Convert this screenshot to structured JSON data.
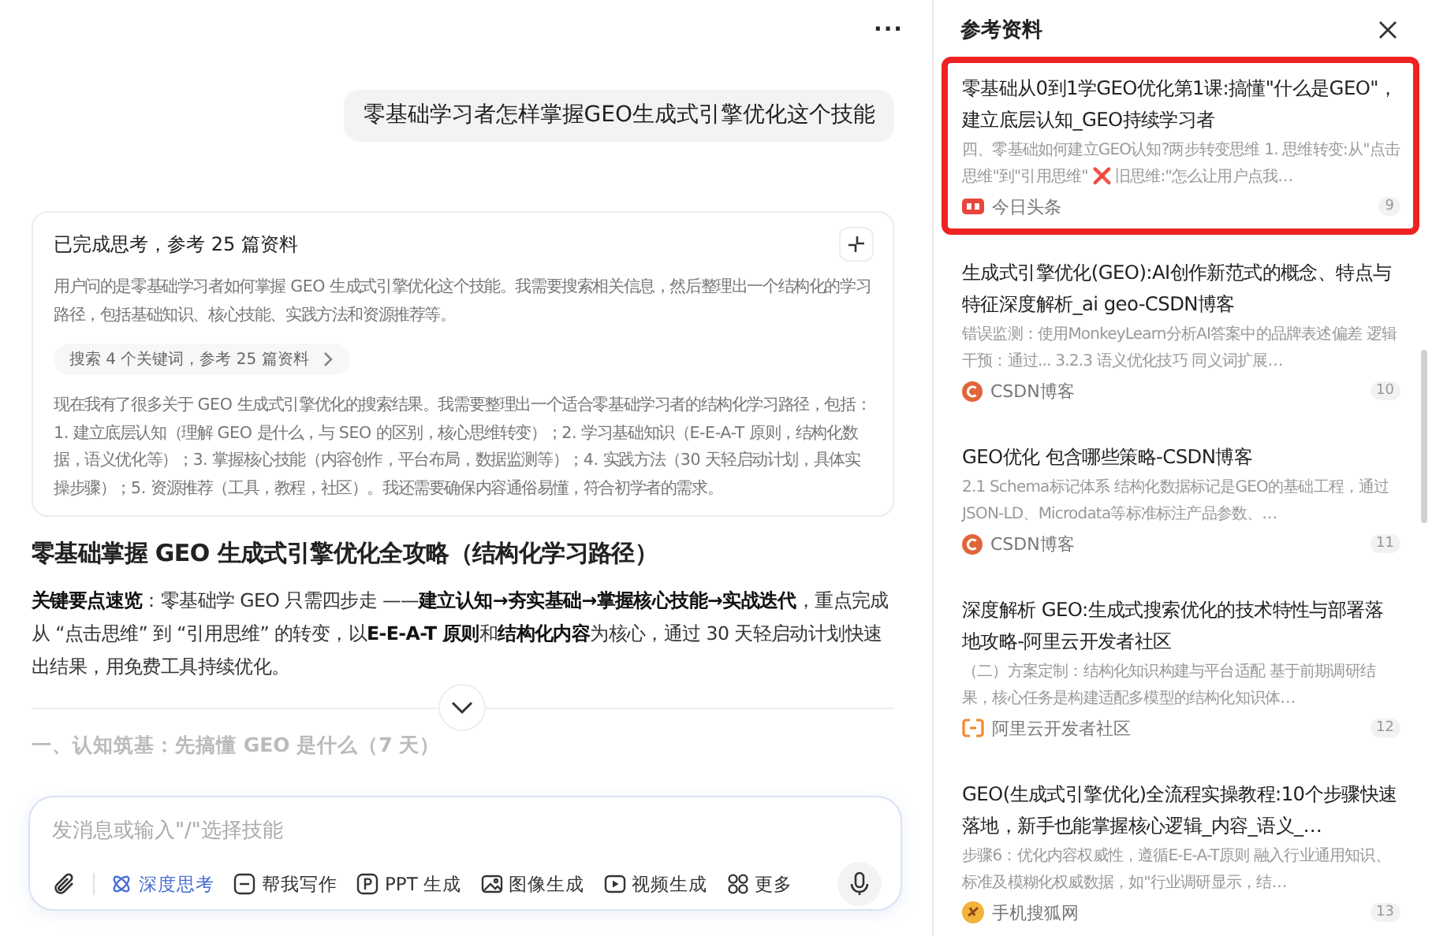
{
  "chat": {
    "menu_icon": "···",
    "user_message": "零基础学习者怎样掌握GEO生成式引擎优化这个技能",
    "thinking": {
      "title": "已完成思考，参考 25 篇资料",
      "expanded": true,
      "paragraphs": [
        "用户问的是零基础学习者如何掌握 GEO 生成式引擎优化这个技能。我需要搜索相关信息，然后整理出一个结构化的学习路径，包括基础知识、核心技能、实践方法和资源推荐等。",
        "现在我有了很多关于 GEO 生成式引擎优化的搜索结果。我需要整理出一个适合零基础学习者的结构化学习路径，包括：1. 建立底层认知（理解 GEO 是什么，与 SEO 的区别，核心思维转变）；2. 学习基础知识（E-E-A-T 原则，结构化数据，语义优化等）；3. 掌握核心技能（内容创作，平台布局，数据监测等）；4. 实践方法（30 天轻启动计划，具体实操步骤）；5. 资源推荐（工具，教程，社区）。我还需要确保内容通俗易懂，符合初学者的需求。"
      ],
      "search_chip": "搜索 4 个关键词，参考 25 篇资料"
    },
    "answer_title": "零基础掌握 GEO 生成式引擎优化全攻略（结构化学习路径）",
    "answer_paragraph": "**关键要点速览**：零基础学 GEO 只需四步走 ——**建立认知→夯实基础→掌握核心技能→实战迭代**，重点完成从 “点击思维” 到 “引用思维” 的转变，以**E-E-A-T 原则**和**结构化内容**为核心，通过 30 天轻启动计划快速出结果，用免费工具持续优化。",
    "next_section": "一、认知筑基：先搞懂 GEO 是什么（7 天）",
    "input": {
      "placeholder": "发消息或输入\"/\"选择技能",
      "tools": [
        {
          "kind": "thinking",
          "label": "深度思考",
          "selected": true
        },
        {
          "kind": "writing",
          "label": "帮我写作",
          "selected": false
        },
        {
          "kind": "ppt",
          "label": "PPT 生成",
          "selected": false
        },
        {
          "kind": "image",
          "label": "图像生成",
          "selected": false
        },
        {
          "kind": "video",
          "label": "视频生成",
          "selected": false
        },
        {
          "kind": "more",
          "label": "更多",
          "selected": false
        }
      ]
    }
  },
  "references": {
    "title": "参考资料",
    "items": [
      {
        "title": "零基础从0到1学GEO优化第1课:搞懂\"什么是GEO\"，建立底层认知_GEO持续学习者",
        "snippet": "四、零基础如何建立GEO认知?两步转变思维 1. 思维转变:从\"点击思维\"到\"引用思维\" ❌ 旧思维:\"怎么让用户点我…",
        "source": "今日头条",
        "kind": "toutiao",
        "number": "9",
        "highlighted": true
      },
      {
        "title": "生成式引擎优化(GEO):AI创作新范式的概念、特点与特征深度解析_ai geo-CSDN博客",
        "snippet": "错误监测：使用MonkeyLearn分析AI答案中的品牌表述偏差 逻辑干预：通过... 3.2.3 语义优化技巧 同义词扩展…",
        "source": "CSDN博客",
        "kind": "csdn",
        "number": "10",
        "highlighted": false
      },
      {
        "title": "GEO优化 包含哪些策略-CSDN博客",
        "snippet": "2.1 Schema标记体系 结构化数据标记是GEO的基础工程，通过JSON-LD、Microdata等标准标注产品参数、…",
        "source": "CSDN博客",
        "kind": "csdn",
        "number": "11",
        "highlighted": false
      },
      {
        "title": "深度解析 GEO:生成式搜索优化的技术特性与部署落地攻略-阿里云开发者社区",
        "snippet": "（二）方案定制：结构化知识构建与平台适配 基于前期调研结果，核心任务是构建适配多模型的结构化知识体…",
        "source": "阿里云开发者社区",
        "kind": "aliyun",
        "number": "12",
        "highlighted": false
      },
      {
        "title": "GEO(生成式引擎优化)全流程实操教程:10个步骤快速落地，新手也能掌握核心逻辑_内容_语义_…",
        "snippet": "步骤6：优化内容权威性，遵循E-E-A-T原则 融入行业通用知识、标准及模糊化权威数据，如\"行业调研显示，结…",
        "source": "手机搜狐网",
        "kind": "sohu",
        "number": "13",
        "highlighted": false
      }
    ]
  }
}
